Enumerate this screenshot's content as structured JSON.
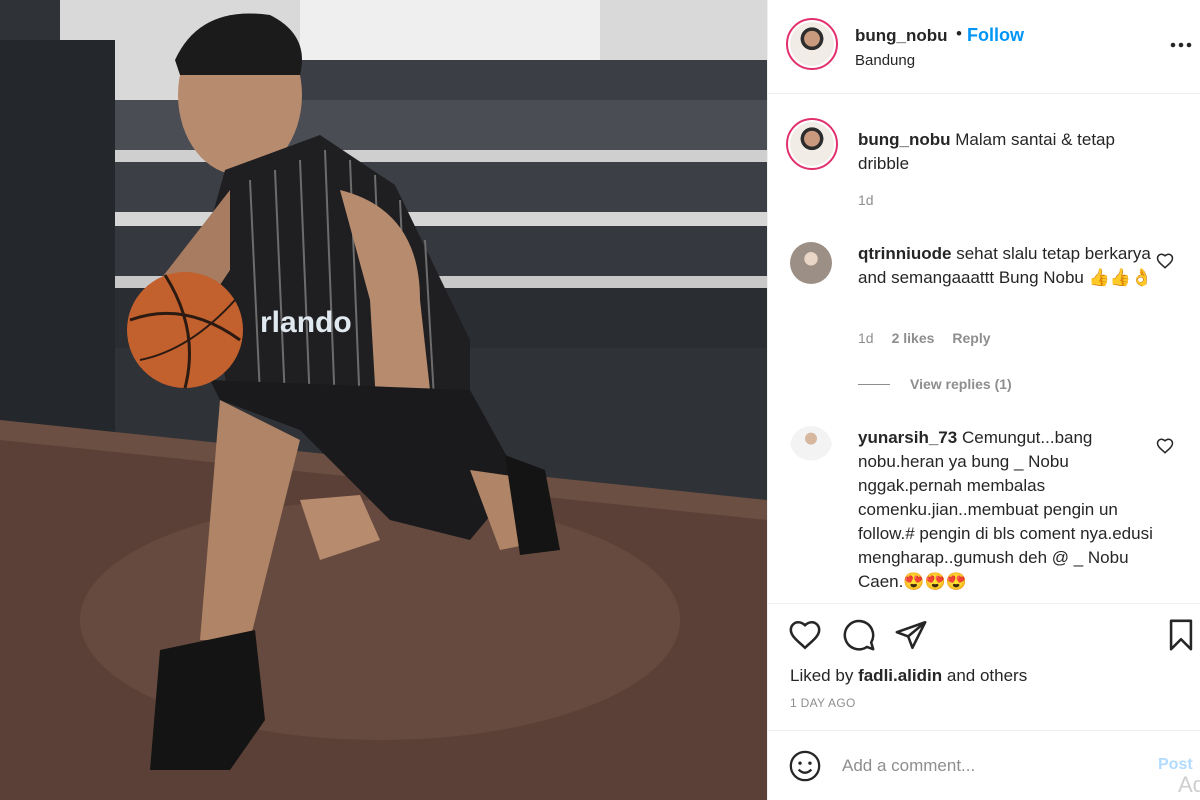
{
  "header": {
    "username": "bung_nobu",
    "separator": "•",
    "follow_label": "Follow",
    "location": "Bandung"
  },
  "caption": {
    "username": "bung_nobu",
    "text": "Malam santai & tetap dribble",
    "time": "1d"
  },
  "comments": [
    {
      "username": "qtrinniuode",
      "text": "sehat slalu tetap berkarya and semangaaattt Bung Nobu 👍👍👌",
      "time": "1d",
      "likes": "2 likes",
      "reply_label": "Reply",
      "view_replies": "View replies (1)"
    },
    {
      "username": "yunarsih_73",
      "text": "Cemungut...bang nobu.heran ya bung _ Nobu nggak.pernah membalas comenku.jian..membuat pengin un follow.# pengin di bls coment nya.edusi mengharap..gumush deh @ _ Nobu Caen.😍😍😍"
    }
  ],
  "actions": {
    "liked_by_prefix": "Liked by",
    "liked_by_user": "fadli.alidin",
    "liked_by_suffix": "and others",
    "time_ago": "1 DAY AGO"
  },
  "add_comment": {
    "placeholder": "Add a comment...",
    "post_label": "Post"
  },
  "watermark": "Ad",
  "icons": {
    "more": "more-horizontal-icon",
    "like": "heart-icon",
    "comment": "comment-bubble-icon",
    "share": "paper-plane-icon",
    "save": "bookmark-icon",
    "emoji": "smiley-icon"
  },
  "colors": {
    "follow": "#0095f6",
    "text": "#262626",
    "muted": "#8e8e8e",
    "post_disabled": "#b3dbff",
    "story_ring": "#e1306c"
  }
}
